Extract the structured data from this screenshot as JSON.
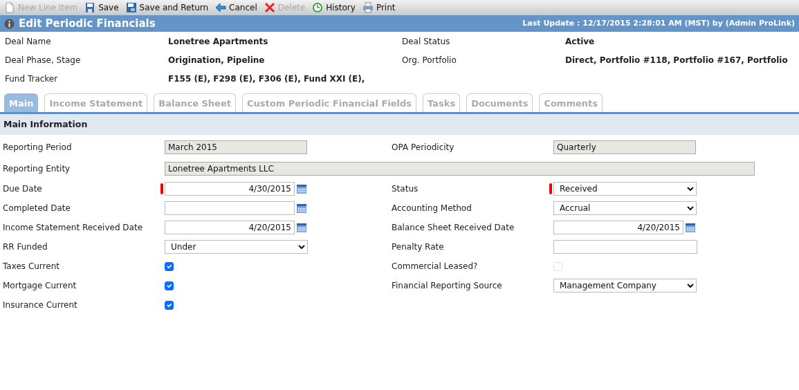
{
  "toolbar": [
    {
      "label": "New Line Item",
      "disabled": true
    },
    {
      "label": "Save",
      "disabled": false
    },
    {
      "label": "Save and Return",
      "disabled": false
    },
    {
      "label": "Cancel",
      "disabled": false
    },
    {
      "label": "Delete",
      "disabled": true
    },
    {
      "label": "History",
      "disabled": false
    },
    {
      "label": "Print",
      "disabled": false
    }
  ],
  "title_bar": {
    "title": "Edit Periodic Financials",
    "last_update": "Last Update : 12/17/2015 2:28:01 AM (MST) by (Admin ProLink)"
  },
  "deal_info": [
    [
      {
        "label": "Deal Name",
        "value": "Lonetree Apartments"
      },
      {
        "label": "Deal Status",
        "value": "Active"
      }
    ],
    [
      {
        "label": "Deal Phase, Stage",
        "value": "Origination, Pipeline"
      },
      {
        "label": "Org. Portfolio",
        "value": "Direct, Portfolio #118, Portfolio #167, Portfolio"
      }
    ],
    [
      {
        "label": "Fund Tracker",
        "value": "F155 (E), F298 (E), F306 (E), Fund XXI (E),"
      }
    ]
  ],
  "tabs": [
    {
      "label": "Main",
      "selected": true
    },
    {
      "label": "Income Statement",
      "selected": false
    },
    {
      "label": "Balance Sheet",
      "selected": false
    },
    {
      "label": "Custom Periodic Financial Fields",
      "selected": false
    },
    {
      "label": "Tasks",
      "selected": false
    },
    {
      "label": "Documents",
      "selected": false
    },
    {
      "label": "Comments",
      "selected": false
    }
  ],
  "section": {
    "title": "Main Information"
  },
  "form_rows": [
    [
      {
        "label": "Reporting Period",
        "kind": "readonly",
        "value": "March 2015"
      },
      {
        "label": "OPA Periodicity",
        "kind": "readonly",
        "value": "Quarterly"
      }
    ],
    [
      {
        "label": "Reporting Entity",
        "kind": "readonly-wide",
        "value": "Lonetree Apartments LLC"
      }
    ],
    [
      {
        "label": "Due Date",
        "kind": "date",
        "value": "4/30/2015",
        "required": true
      },
      {
        "label": "Status",
        "kind": "select",
        "value": "Received",
        "required": true
      }
    ],
    [
      {
        "label": "Completed Date",
        "kind": "date",
        "required": false
      },
      {
        "label": "Accounting Method",
        "kind": "select",
        "value": "Accrual",
        "required": false
      }
    ],
    [
      {
        "label": "Income Statement Received Date",
        "kind": "date",
        "value": "4/20/2015",
        "required": false
      },
      {
        "label": "Balance Sheet Received Date",
        "kind": "date",
        "value": "4/20/2015",
        "required": false
      }
    ],
    [
      {
        "label": "RR Funded",
        "kind": "select",
        "value": "Under",
        "required": false
      },
      {
        "label": "Penalty Rate",
        "kind": "text",
        "required": false
      }
    ],
    [
      {
        "label": "Taxes Current",
        "kind": "checkbox",
        "checked": true
      },
      {
        "label": "Commercial Leased?",
        "kind": "checkbox",
        "checked": false
      }
    ],
    [
      {
        "label": "Mortgage Current",
        "kind": "checkbox",
        "checked": true
      },
      {
        "label": "Financial Reporting Source",
        "kind": "select",
        "value": "Management Company",
        "required": false
      }
    ],
    [
      {
        "label": "Insurance Current",
        "kind": "checkbox",
        "checked": true
      }
    ]
  ]
}
